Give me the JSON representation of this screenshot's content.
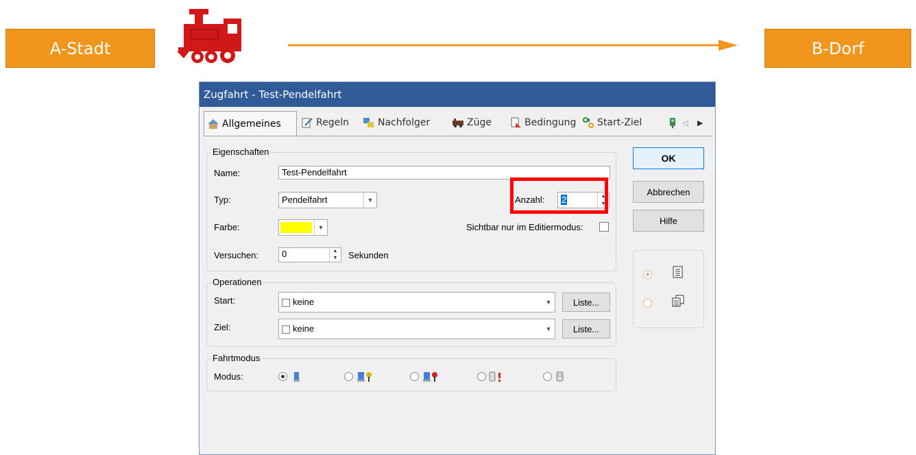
{
  "stations": {
    "start": "A-Stadt",
    "end": "B-Dorf"
  },
  "train_icon": "steam-locomotive-icon",
  "colors": {
    "orange": "#f0961c",
    "titlebar": "#305a98",
    "highlight": "#ff0000",
    "farbe": "#ffff00"
  },
  "dialog": {
    "title": "Zugfahrt - Test-Pendelfahrt",
    "tabs": [
      "Allgemeines",
      "Regeln",
      "Nachfolger",
      "Züge",
      "Bedingung",
      "Start-Ziel"
    ],
    "eigenschaften": {
      "group_label": "Eigenschaften",
      "name_label": "Name:",
      "name_value": "Test-Pendelfahrt",
      "typ_label": "Typ:",
      "typ_value": "Pendelfahrt",
      "anzahl_label": "Anzahl:",
      "anzahl_value": "2",
      "farbe_label": "Farbe:",
      "sichtbar_label": "Sichtbar nur im Editiermodus:",
      "versuchen_label": "Versuchen:",
      "versuchen_value": "0",
      "sekunden_label": "Sekunden"
    },
    "operationen": {
      "group_label": "Operationen",
      "start_label": "Start:",
      "start_value": "keine",
      "ziel_label": "Ziel:",
      "ziel_value": "keine",
      "liste_label": "Liste..."
    },
    "fahrtmodus": {
      "group_label": "Fahrtmodus",
      "modus_label": "Modus:"
    },
    "buttons": {
      "ok": "OK",
      "abbrechen": "Abbrechen",
      "hilfe": "Hilfe"
    }
  }
}
